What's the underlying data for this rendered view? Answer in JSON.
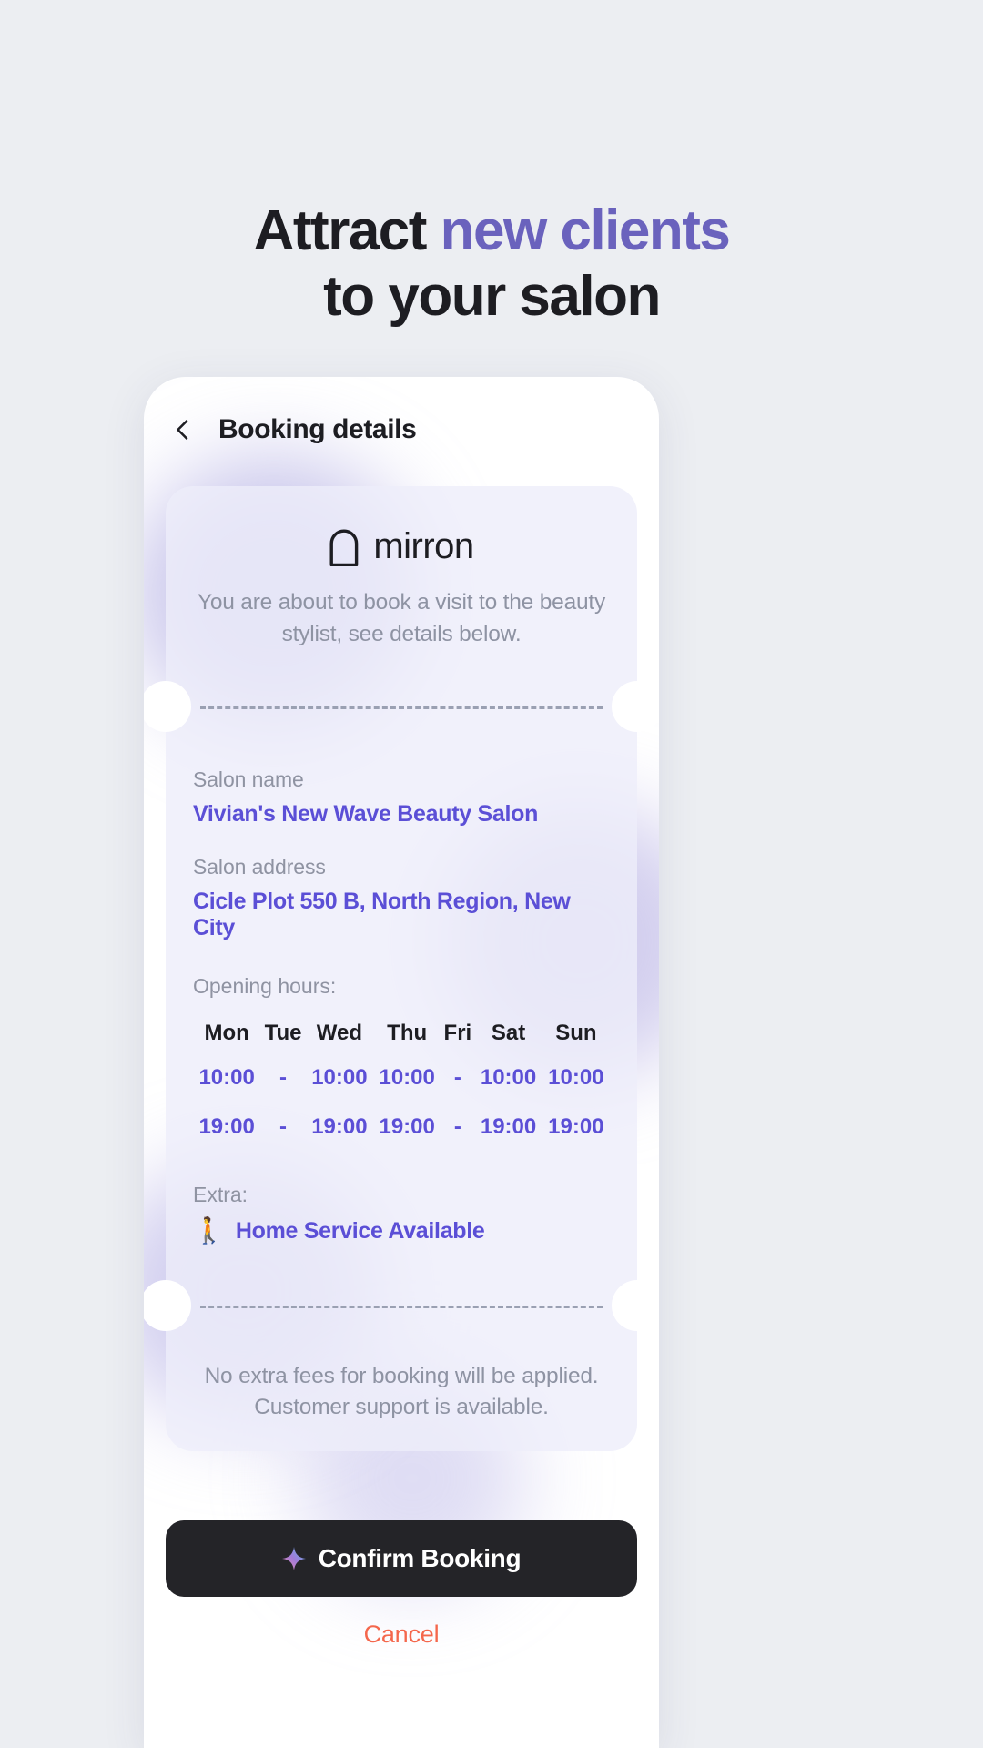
{
  "hero": {
    "line1_plain": "Attract ",
    "line1_accent": "new clients",
    "line2": "to your salon",
    "accent_color": "#6a62bd"
  },
  "appbar": {
    "back_icon": "chevron-left-icon",
    "title": "Booking details"
  },
  "ticket": {
    "brand": {
      "mark_icon": "arch-logo-icon",
      "name": "mirron"
    },
    "lead": "You are about to book a visit to the beauty stylist, see details below.",
    "fields": [
      {
        "label": "Salon name",
        "value": "Vivian's New Wave Beauty Salon"
      },
      {
        "label": "Salon address",
        "value": "Cicle Plot 550 B, North Region, New City"
      }
    ],
    "hours": {
      "label": "Opening hours:",
      "days": [
        "Mon",
        "Tue",
        "Wed",
        "Thu",
        "Fri",
        "Sat",
        "Sun"
      ],
      "open": [
        "10:00",
        "-",
        "10:00",
        "10:00",
        "-",
        "10:00",
        "10:00"
      ],
      "close": [
        "19:00",
        "-",
        "19:00",
        "19:00",
        "-",
        "19:00",
        "19:00"
      ]
    },
    "extra": {
      "label": "Extra:",
      "icon": "walking-person-icon",
      "icon_glyph": "🚶",
      "value": "Home Service Available"
    },
    "footer": "No extra fees for booking will be applied. Customer support is available."
  },
  "actions": {
    "confirm_icon": "sparkle-icon",
    "confirm_label": "Confirm Booking",
    "cancel_label": "Cancel",
    "cancel_color": "#f4674c",
    "confirm_bg": "#242428"
  }
}
